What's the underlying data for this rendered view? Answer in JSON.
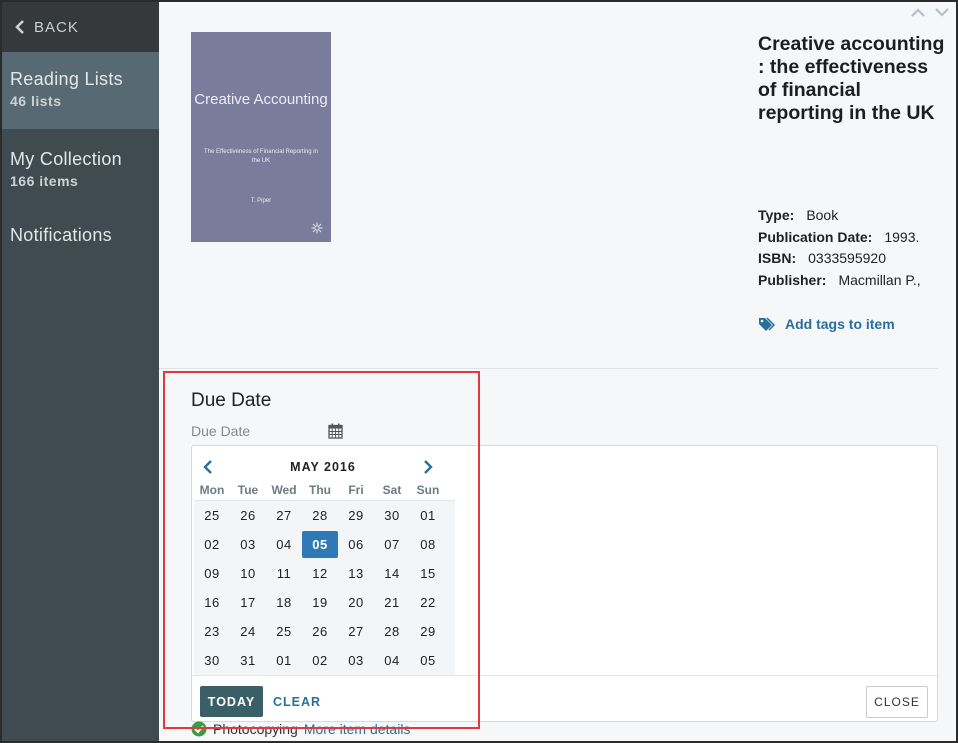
{
  "sidebar": {
    "back_label": "BACK",
    "items": [
      {
        "label": "Reading Lists",
        "sub": "46 lists"
      },
      {
        "label": "My Collection",
        "sub": "166 items"
      },
      {
        "label": "Notifications",
        "sub": ""
      }
    ]
  },
  "item": {
    "cover": {
      "title": "Creative Accounting",
      "subtitle": "The Effectiveness of Financial Reporting in the UK",
      "author": "T. Piper"
    },
    "title": "Creative accounting : the effectiveness of financial reporting in the UK",
    "meta": [
      {
        "key": "Type:",
        "value": "Book"
      },
      {
        "key": "Publication Date:",
        "value": "1993."
      },
      {
        "key": "ISBN:",
        "value": "0333595920"
      },
      {
        "key": "Publisher:",
        "value": "Macmillan P.,"
      }
    ],
    "tags_label": "Add tags to item"
  },
  "due": {
    "title": "Due Date",
    "placeholder": "Due Date"
  },
  "calendar": {
    "month_label": "MAY 2016",
    "weekdays": [
      "Mon",
      "Tue",
      "Wed",
      "Thu",
      "Fri",
      "Sat",
      "Sun"
    ],
    "weeks": [
      [
        "25",
        "26",
        "27",
        "28",
        "29",
        "30",
        "01"
      ],
      [
        "02",
        "03",
        "04",
        "05",
        "06",
        "07",
        "08"
      ],
      [
        "09",
        "10",
        "11",
        "12",
        "13",
        "14",
        "15"
      ],
      [
        "16",
        "17",
        "18",
        "19",
        "20",
        "21",
        "22"
      ],
      [
        "23",
        "24",
        "25",
        "26",
        "27",
        "28",
        "29"
      ],
      [
        "30",
        "31",
        "01",
        "02",
        "03",
        "04",
        "05"
      ]
    ],
    "selected": "05",
    "today_label": "TODAY",
    "clear_label": "CLEAR",
    "close_label": "CLOSE"
  },
  "below": {
    "text": "Photocopying",
    "more_label": "More item details"
  },
  "colors": {
    "sidebar_bg": "#3f4a51",
    "active_bg": "#576a73",
    "accent": "#2f79b6",
    "link": "#2a6f9c",
    "highlight": "#e0393e"
  }
}
